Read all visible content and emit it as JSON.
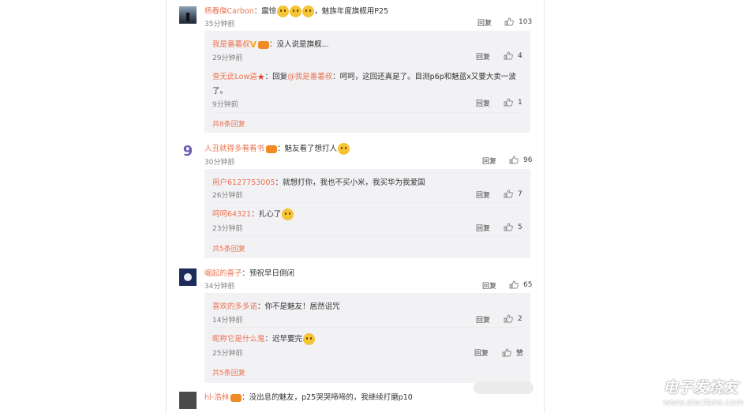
{
  "thread": [
    {
      "user": "杨春傑Carbon",
      "text": "：震惊",
      "text2": "，魅族年度旗舰用P25",
      "time": "35分钟前",
      "reply_label": "回复",
      "likes": "103",
      "replies": [
        {
          "user": "我是番薯叔",
          "text": "：没人说是旗舰...",
          "time": "29分钟前",
          "reply_label": "回复",
          "likes": "4"
        },
        {
          "user": "查无此Low逼",
          "text_lead": "：回复",
          "mention": "@我是番薯叔",
          "text": "：呵呵，这回还真是了。目测p6p和魅蓝x又要大卖一波",
          "text_cont": "了。",
          "time": "9分钟前",
          "reply_label": "回复",
          "likes": "1"
        }
      ],
      "more_label": "共8条回复"
    },
    {
      "user": "人丑就得多看看书",
      "text": "：魅友看了想打人",
      "time": "30分钟前",
      "reply_label": "回复",
      "likes": "96",
      "replies": [
        {
          "user": "用户6127753005",
          "text": "：就想打你，我也不买小米，我买华为我爱国",
          "time": "26分钟前",
          "reply_label": "回复",
          "likes": "7"
        },
        {
          "user": "呵呵64321",
          "text": "：扎心了",
          "time": "23分钟前",
          "reply_label": "回复",
          "likes": "5"
        }
      ],
      "more_label": "共5条回复"
    },
    {
      "user": "崛起的喜子",
      "text": "：预祝早日倒闭",
      "time": "34分钟前",
      "reply_label": "回复",
      "likes": "65",
      "replies": [
        {
          "user": "喜欢的多多诺",
          "text": "：你不是魅友！居然诅咒",
          "time": "14分钟前",
          "reply_label": "回复",
          "likes": "2"
        },
        {
          "user": "昵称它是什么鬼",
          "text": "：迟早要完",
          "time": "25分钟前",
          "reply_label": "回复",
          "likes": "赞"
        }
      ],
      "more_label": "共5条回复"
    },
    {
      "user": "hl-浩林",
      "text": "：没出息的魅友，p25哭哭啼啼的，我继续打磨p10"
    }
  ],
  "watermark": {
    "brand": "电子发烧友",
    "url": "www.elecfans.com"
  },
  "icons": {
    "like": "thumbs-up-icon",
    "emoji": "emoji-icon",
    "verified": "verified-v-icon",
    "vip": "vip-badge-icon",
    "star": "star-badge-icon"
  },
  "colors": {
    "username": "#eb7350",
    "reply_box": "#f2f2f5",
    "text": "#333333",
    "meta": "#808080"
  }
}
